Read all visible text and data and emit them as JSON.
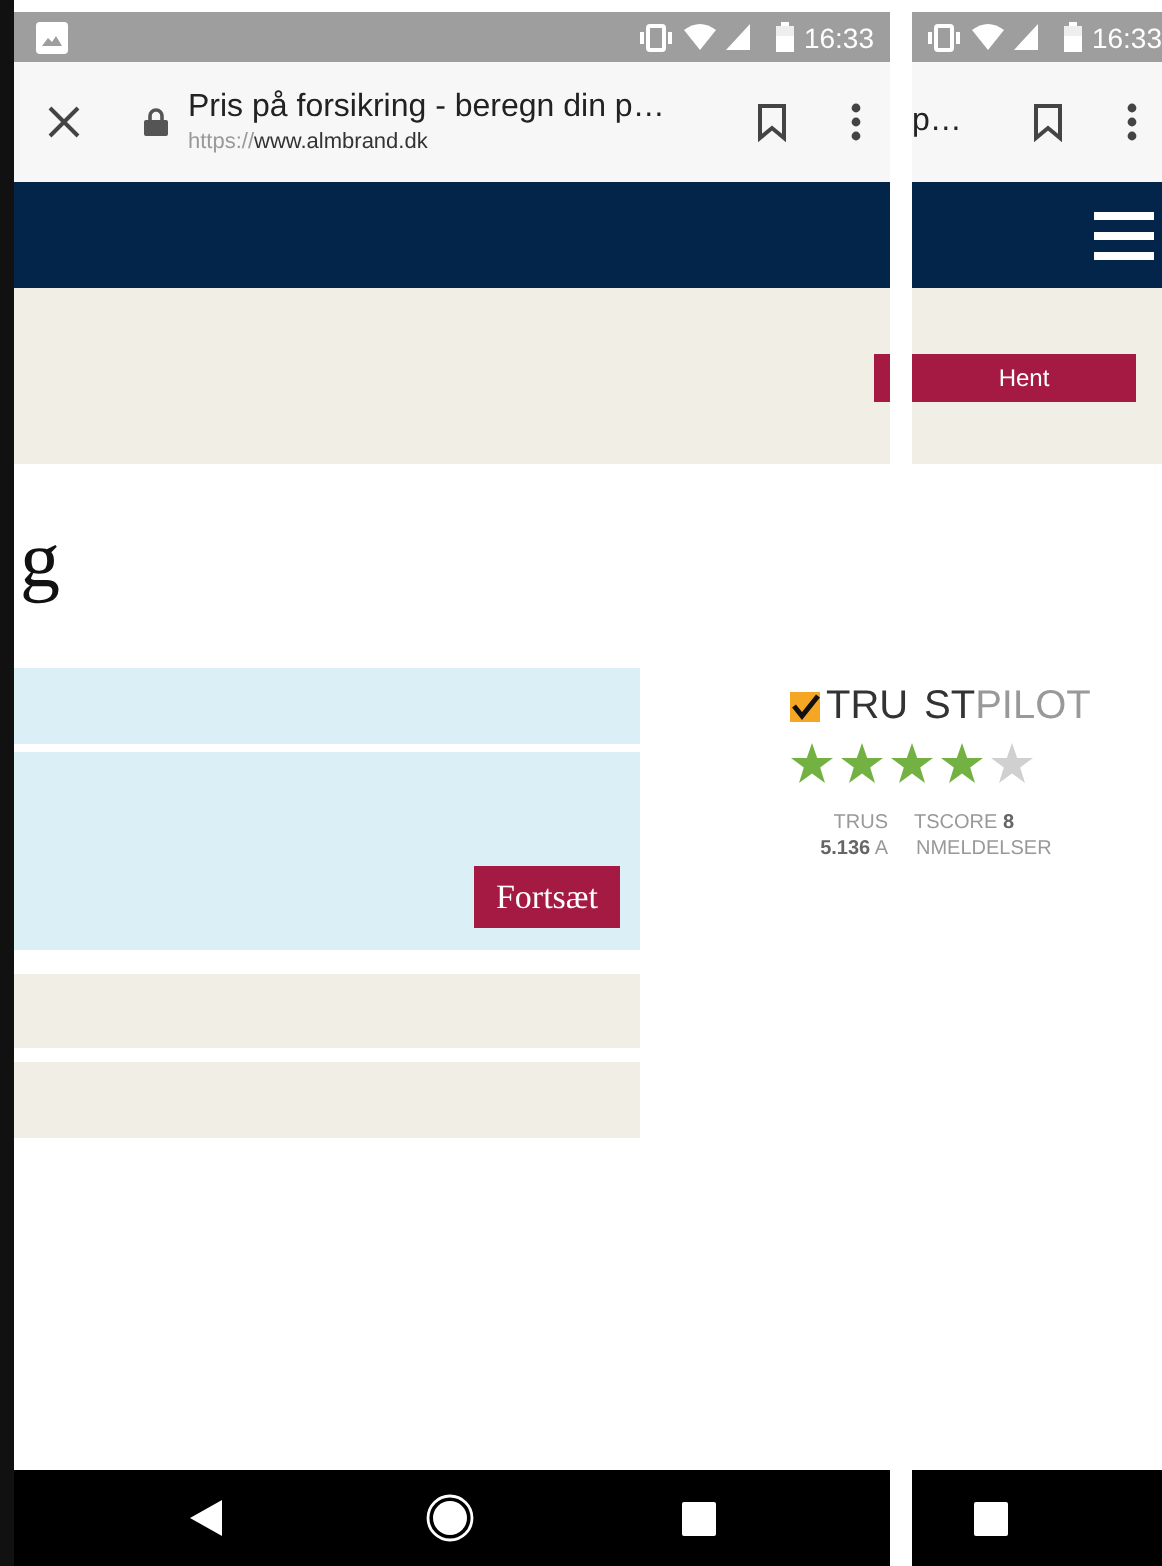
{
  "status_bars": [
    {
      "time": "16:33"
    },
    {
      "time": "16:33"
    }
  ],
  "browser_bars": [
    {
      "title": "Pris på forsikring - beregn din p…",
      "url_scheme": "https://",
      "url_host": "www.almbrand.dk"
    },
    {
      "title": "p…"
    }
  ],
  "banner": {
    "button": "Hent"
  },
  "heading": "g",
  "form": {
    "button": "Fortsæt"
  },
  "trustpilot": {
    "logo_left": "TRU",
    "logo_right_strong": "ST",
    "logo_right_light": "PILOT",
    "stars": 4,
    "score_left": "TRUS",
    "score_right": "TSCORE **8**",
    "reviews_left": "**5.136** A",
    "reviews_right": "NMELDELSER"
  }
}
